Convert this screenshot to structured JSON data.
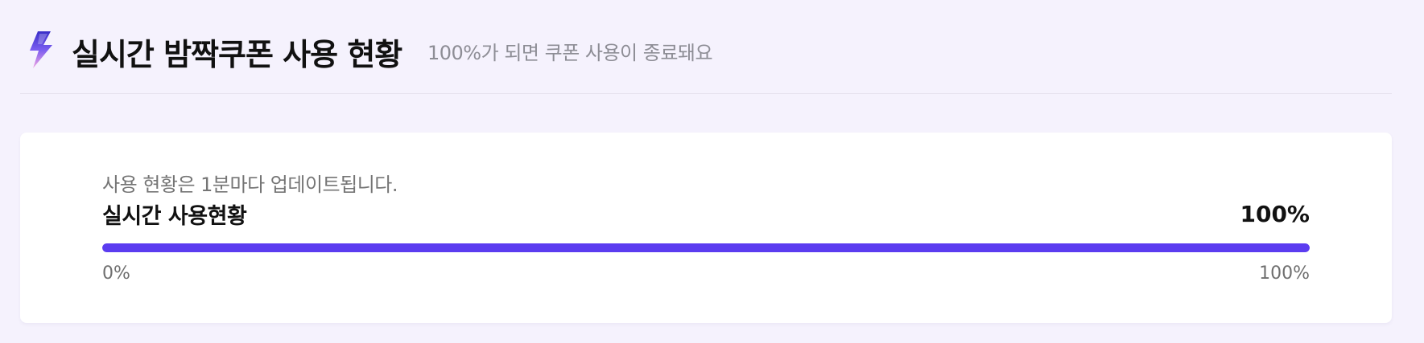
{
  "header": {
    "icon": "lightning-bolt-icon",
    "title": "실시간 밤짝쿠폰 사용 현황",
    "subtitle": "100%가 되면 쿠폰 사용이 종료돼요"
  },
  "usage_card": {
    "update_note": "사용 현황은 1분마다 업데이트됩니다.",
    "label": "실시간 사용현황",
    "percent_text": "100%",
    "progress": 1.0,
    "scale_min": "0%",
    "scale_max": "100%"
  },
  "colors": {
    "accent": "#5b3cf0",
    "background": "#f5f2fd",
    "card": "#ffffff"
  }
}
